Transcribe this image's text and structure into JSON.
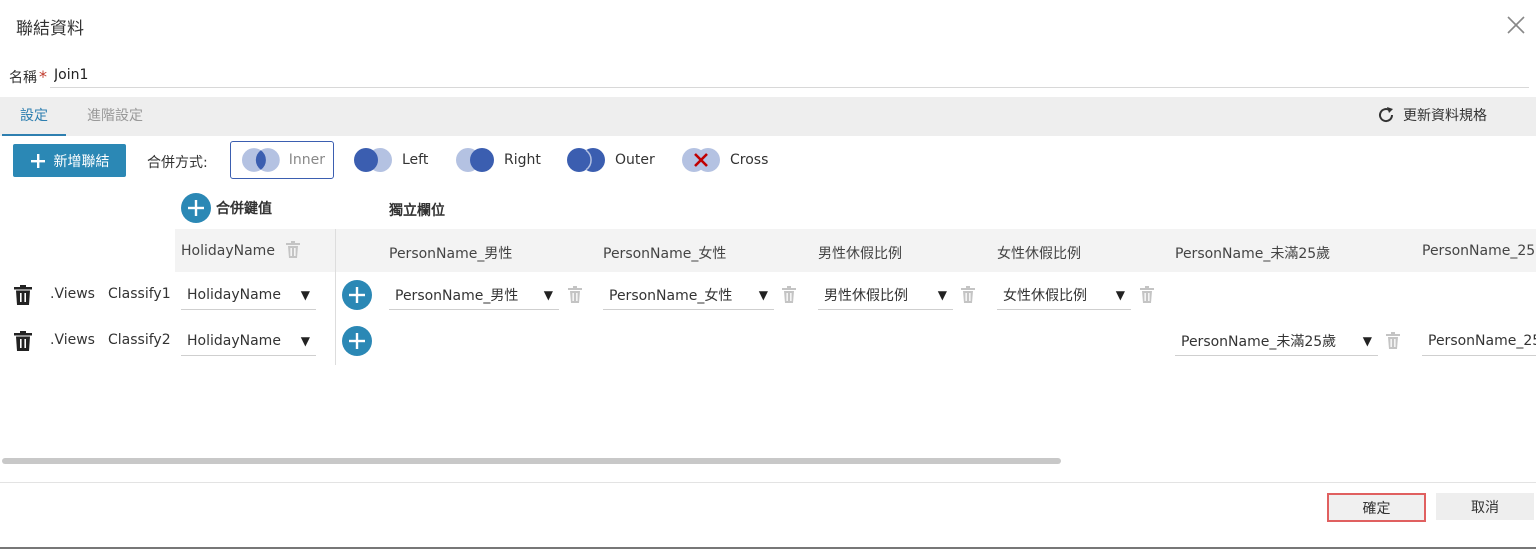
{
  "dialog": {
    "title": "聯結資料"
  },
  "name": {
    "label": "名稱",
    "required_mark": "*",
    "value": "Join1"
  },
  "tabs": [
    {
      "label": "設定",
      "active": true
    },
    {
      "label": "進階設定",
      "active": false
    }
  ],
  "refresh_label": "更新資料規格",
  "toolbar": {
    "add_join_label": "新增聯結",
    "join_mode_label": "合併方式:",
    "join_options": [
      {
        "label": "Inner",
        "selected": true
      },
      {
        "label": "Left",
        "selected": false
      },
      {
        "label": "Right",
        "selected": false
      },
      {
        "label": "Outer",
        "selected": false
      },
      {
        "label": "Cross",
        "selected": false
      }
    ]
  },
  "grid": {
    "merge_key_label": "合併鍵值",
    "independent_label": "獨立欄位",
    "key_header": "HolidayName",
    "column_headers": [
      "PersonName_男性",
      "PersonName_女性",
      "男性休假比例",
      "女性休假比例",
      "PersonName_未滿25歲",
      "PersonName_25"
    ],
    "rows": [
      {
        "table_prefix": ".Views",
        "table_name": "Classify1",
        "key": "HolidayName",
        "fields": [
          "PersonName_男性",
          "PersonName_女性",
          "男性休假比例",
          "女性休假比例"
        ]
      },
      {
        "table_prefix": ".Views",
        "table_name": "Classify2",
        "key": "HolidayName",
        "fields": [
          "PersonName_未滿25歲",
          "PersonName_25"
        ]
      }
    ]
  },
  "footer": {
    "ok_label": "確定",
    "cancel_label": "取消"
  },
  "colors": {
    "accent": "#2b88b5",
    "tab_active": "#2e7fb0",
    "venn_dark": "#3b5eb0",
    "venn_light": "#b4c2e2",
    "ok_border": "#e06060",
    "cross_mark": "#c00000"
  }
}
